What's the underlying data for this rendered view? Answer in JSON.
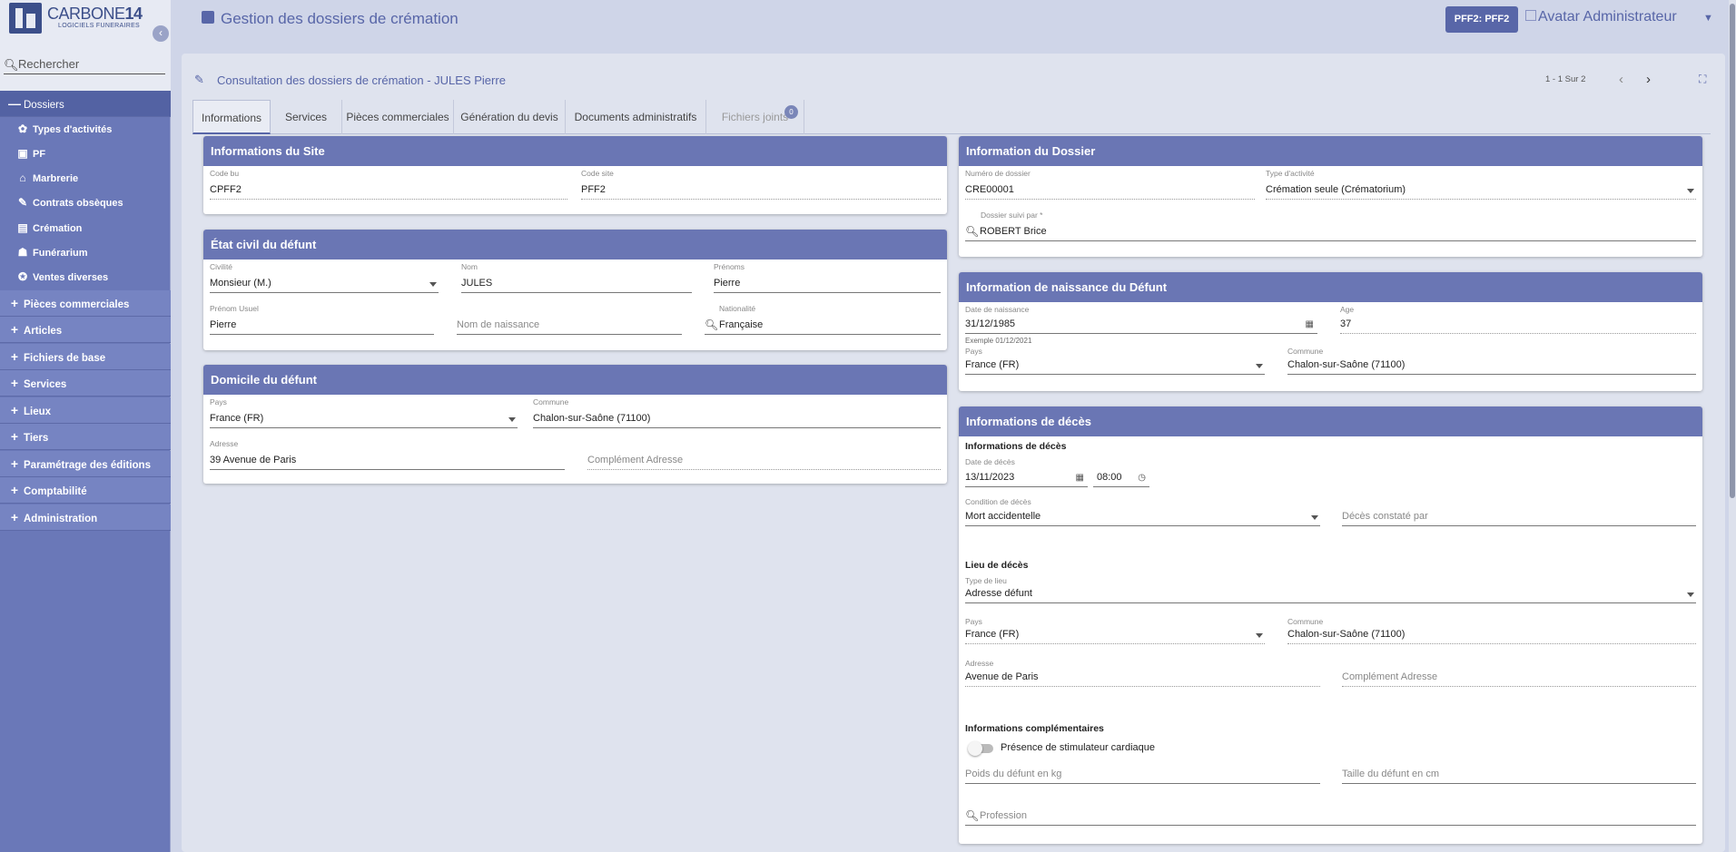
{
  "brand": {
    "name_light": "CARBONE",
    "name_bold": "14",
    "tagline": "LOGICIELS FUNERAIRES"
  },
  "sidebar": {
    "search_placeholder": "Rechercher",
    "dossiers": {
      "symbol": "—",
      "label": "Dossiers"
    },
    "sub_items": [
      {
        "label": "Types d'activités"
      },
      {
        "label": "PF"
      },
      {
        "label": "Marbrerie"
      },
      {
        "label": "Contrats obsèques"
      },
      {
        "label": "Crémation"
      },
      {
        "label": "Funérarium"
      },
      {
        "label": "Ventes diverses"
      }
    ],
    "groups": [
      {
        "symbol": "+",
        "label": "Pièces commerciales"
      },
      {
        "symbol": "+",
        "label": "Articles"
      },
      {
        "symbol": "+",
        "label": "Fichiers de base"
      },
      {
        "symbol": "+",
        "label": "Services"
      },
      {
        "symbol": "+",
        "label": "Lieux"
      },
      {
        "symbol": "+",
        "label": "Tiers"
      },
      {
        "symbol": "+",
        "label": "Paramétrage des éditions"
      },
      {
        "symbol": "+",
        "label": "Comptabilité"
      },
      {
        "symbol": "+",
        "label": "Administration"
      }
    ]
  },
  "header": {
    "title": "Gestion des dossiers de crémation",
    "site_badge": "PFF2: PFF2",
    "avatar_alt": "Avatar",
    "user": "Administrateur"
  },
  "panel": {
    "title": "Consultation des dossiers de crémation - JULES Pierre",
    "pager": "1 - 1 Sur 2"
  },
  "tabs": [
    {
      "label": "Informations"
    },
    {
      "label": "Services"
    },
    {
      "label": "Pièces commerciales"
    },
    {
      "label": "Génération du devis"
    },
    {
      "label": "Documents administratifs"
    },
    {
      "label": "Fichiers joints",
      "badge": "0"
    }
  ],
  "site": {
    "title": "Informations du Site",
    "code_bu": {
      "label": "Code bu",
      "value": "CPFF2"
    },
    "code_site": {
      "label": "Code site",
      "value": "PFF2"
    }
  },
  "etat_civil": {
    "title": "État civil du défunt",
    "civilite": {
      "label": "Civilité",
      "value": "Monsieur (M.)"
    },
    "nom": {
      "label": "Nom",
      "value": "JULES"
    },
    "prenoms": {
      "label": "Prénoms",
      "value": "Pierre"
    },
    "prenom_usuel": {
      "label": "Prénom Usuel",
      "value": "Pierre"
    },
    "nom_naissance": {
      "placeholder": "Nom de naissance"
    },
    "nationalite": {
      "label": "Nationalité",
      "value": "Française"
    }
  },
  "domicile": {
    "title": "Domicile du défunt",
    "pays": {
      "label": "Pays",
      "value": "France (FR)"
    },
    "commune": {
      "label": "Commune",
      "value": "Chalon-sur-Saône (71100)"
    },
    "adresse": {
      "label": "Adresse",
      "value": "39 Avenue de Paris"
    },
    "complement": {
      "placeholder": "Complément Adresse"
    }
  },
  "dossier": {
    "title": "Information du Dossier",
    "numero": {
      "label": "Numéro de dossier",
      "value": "CRE00001"
    },
    "type_activite": {
      "label": "Type d'activité",
      "value": "Crémation seule (Crématorium)"
    },
    "suivi_par": {
      "label": "Dossier suivi par *",
      "value": "ROBERT Brice"
    }
  },
  "naissance": {
    "title": "Information de naissance du Défunt",
    "date": {
      "label": "Date de naissance",
      "value": "31/12/1985",
      "hint": "Exemple 01/12/2021"
    },
    "age": {
      "label": "Age",
      "value": "37"
    },
    "pays": {
      "label": "Pays",
      "value": "France (FR)"
    },
    "commune": {
      "label": "Commune",
      "value": "Chalon-sur-Saône (71100)"
    }
  },
  "deces": {
    "title": "Informations de décès",
    "section_info": "Informations de décès",
    "date": {
      "label": "Date de décès",
      "value": "13/11/2023"
    },
    "heure": {
      "value": "08:00"
    },
    "condition": {
      "label": "Condition de décès",
      "value": "Mort accidentelle"
    },
    "constate_par": {
      "placeholder": "Décès constaté par"
    },
    "section_lieu": "Lieu de décès",
    "type_lieu": {
      "label": "Type de lieu",
      "value": "Adresse défunt"
    },
    "pays": {
      "label": "Pays",
      "value": "France (FR)"
    },
    "commune": {
      "label": "Commune",
      "value": "Chalon-sur-Saône (71100)"
    },
    "adresse": {
      "label": "Adresse",
      "value": "Avenue de Paris"
    },
    "complement": {
      "placeholder": "Complément Adresse"
    },
    "section_compl": "Informations complémentaires",
    "stimulateur": {
      "label": "Présence de stimulateur cardiaque",
      "checked": false
    },
    "poids": {
      "placeholder": "Poids du défunt en kg"
    },
    "taille": {
      "placeholder": "Taille du défunt en cm"
    },
    "profession": {
      "placeholder": "Profession"
    }
  },
  "colors": {
    "primary": "#5866a8",
    "sidebar": "#6a78b8",
    "card_header": "#6a76b4",
    "background": "#cfd5e8"
  }
}
